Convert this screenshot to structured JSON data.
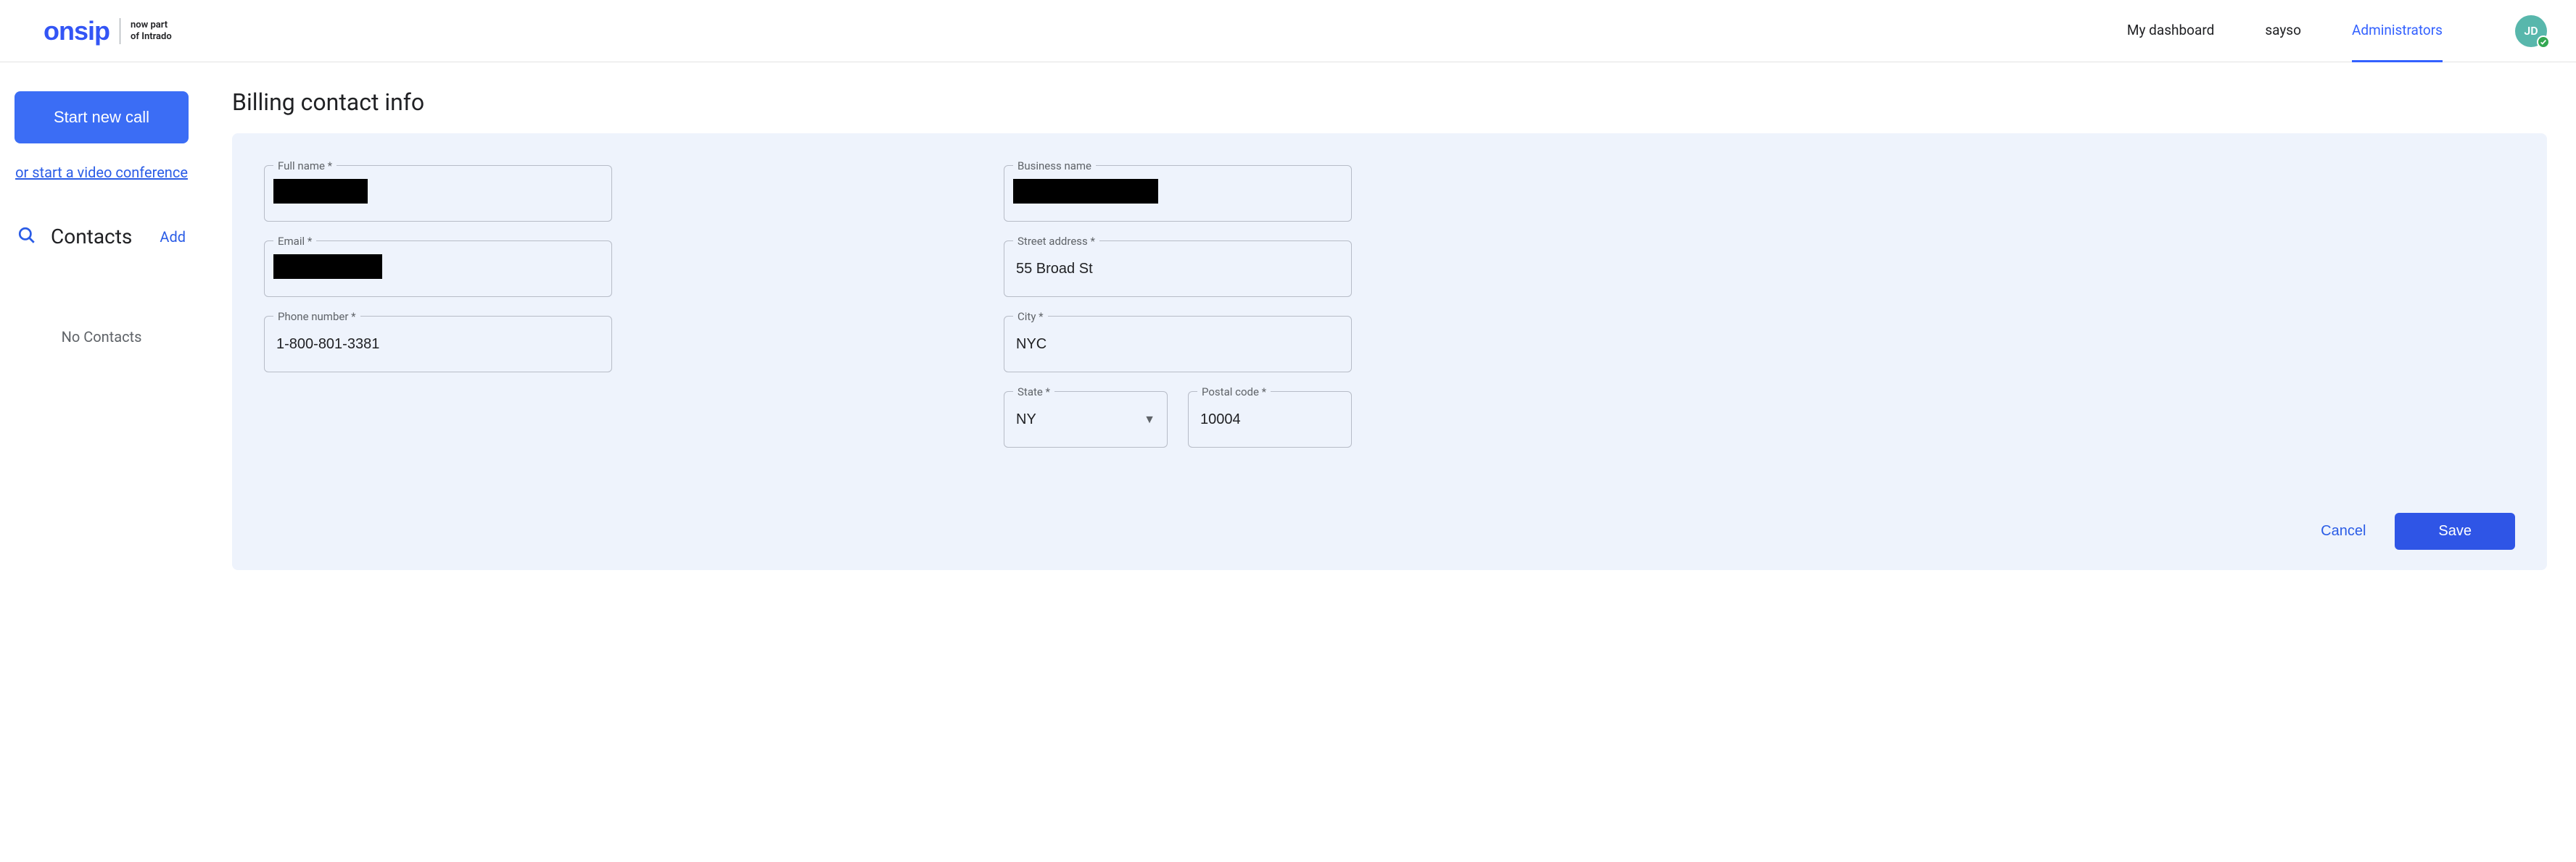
{
  "brand": {
    "logo_text": "onsip",
    "tagline_line1": "now part",
    "tagline_line2": "of Intrado"
  },
  "nav": {
    "dashboard": "My dashboard",
    "sayso": "sayso",
    "administrators": "Administrators"
  },
  "avatar": {
    "initials": "JD"
  },
  "sidebar": {
    "start_call": "Start new call",
    "video_conf": "or start a video conference",
    "contacts_title": "Contacts",
    "add": "Add",
    "no_contacts": "No Contacts"
  },
  "page": {
    "title": "Billing contact info"
  },
  "form": {
    "full_name": {
      "label": "Full name *",
      "value": ""
    },
    "email": {
      "label": "Email *",
      "value": ""
    },
    "phone": {
      "label": "Phone number *",
      "value": "1-800-801-3381"
    },
    "business_name": {
      "label": "Business name",
      "value": ""
    },
    "street": {
      "label": "Street address *",
      "value": "55 Broad St"
    },
    "city": {
      "label": "City *",
      "value": "NYC"
    },
    "state": {
      "label": "State *",
      "value": "NY"
    },
    "postal": {
      "label": "Postal code *",
      "value": "10004"
    }
  },
  "actions": {
    "cancel": "Cancel",
    "save": "Save"
  }
}
